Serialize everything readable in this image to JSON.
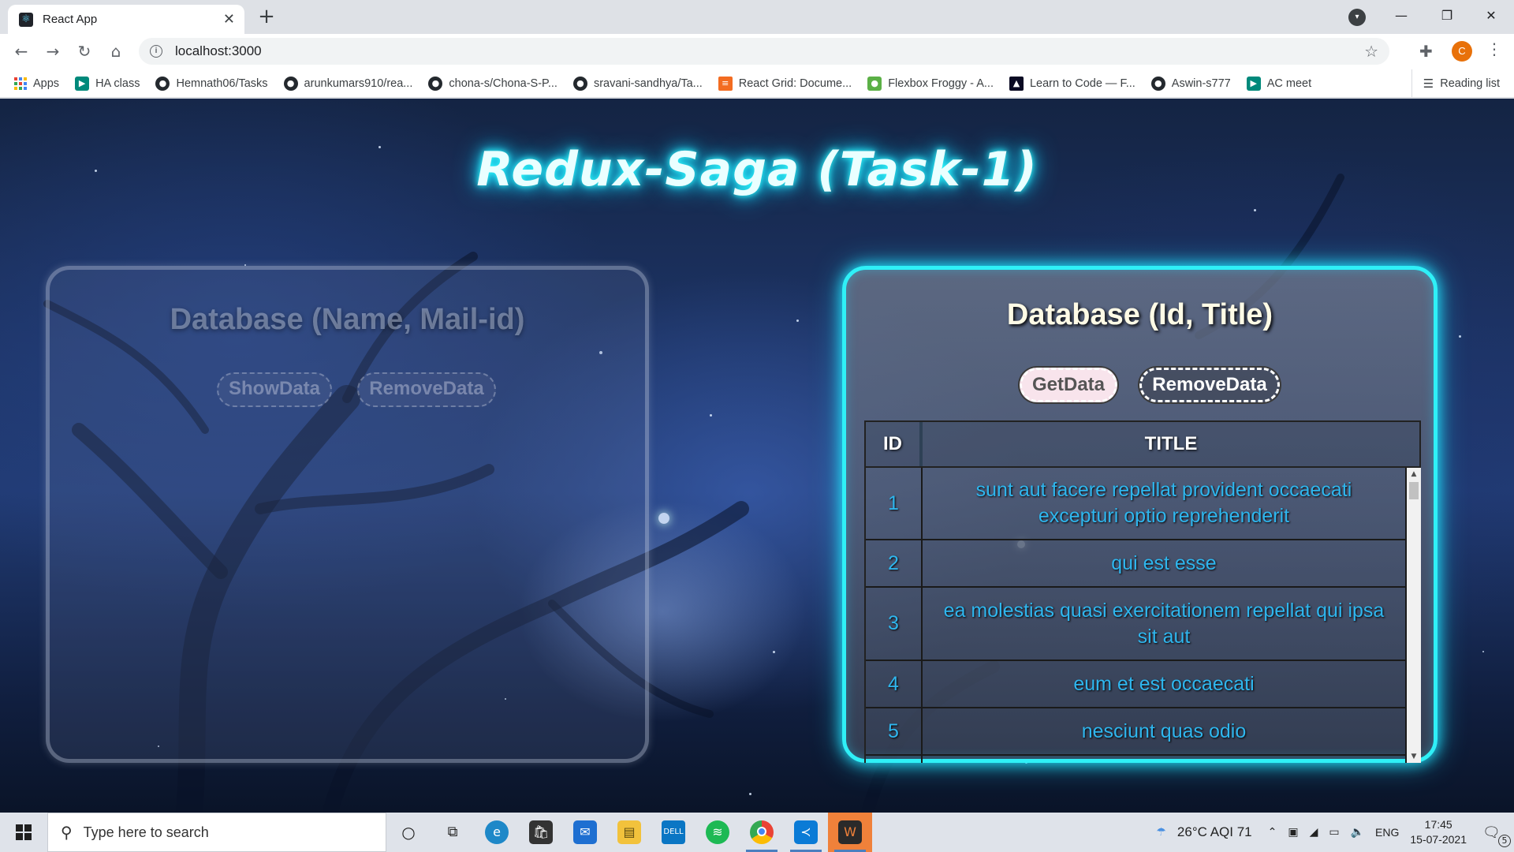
{
  "browser": {
    "tab_title": "React App",
    "tab_close": "✕",
    "new_tab": "+",
    "url": "localhost:3000",
    "window_controls": {
      "minimize": "—",
      "maximize": "❐",
      "close": "✕"
    },
    "profile_initial": "C"
  },
  "bookmarks": {
    "items": [
      {
        "label": "Apps",
        "icon": "apps-grid-icon"
      },
      {
        "label": "HA class",
        "icon": "meet-icon"
      },
      {
        "label": "Hemnath06/Tasks",
        "icon": "github-icon"
      },
      {
        "label": "arunkumars910/rea...",
        "icon": "github-icon"
      },
      {
        "label": "chona-s/Chona-S-P...",
        "icon": "github-icon"
      },
      {
        "label": "sravani-sandhya/Ta...",
        "icon": "github-icon"
      },
      {
        "label": "React Grid: Docume...",
        "icon": "react-grid-icon"
      },
      {
        "label": "Flexbox Froggy - A...",
        "icon": "froggy-icon"
      },
      {
        "label": "Learn to Code — F...",
        "icon": "freecodecamp-icon"
      },
      {
        "label": "Aswin-s777",
        "icon": "github-icon"
      },
      {
        "label": "AC meet",
        "icon": "meet-icon"
      }
    ],
    "reading_list": "Reading list"
  },
  "page": {
    "title": "Redux-Saga (Task-1)",
    "left_card": {
      "heading": "Database (Name, Mail-id)",
      "show_button": "ShowData",
      "remove_button": "RemoveData"
    },
    "right_card": {
      "heading": "Database (Id, Title)",
      "get_button": "GetData",
      "remove_button": "RemoveData",
      "table": {
        "headers": [
          "ID",
          "TITLE"
        ],
        "rows": [
          {
            "id": "1",
            "title": "sunt aut facere repellat provident occaecati excepturi optio reprehenderit"
          },
          {
            "id": "2",
            "title": "qui est esse"
          },
          {
            "id": "3",
            "title": "ea molestias quasi exercitationem repellat qui ipsa sit aut"
          },
          {
            "id": "4",
            "title": "eum et est occaecati"
          },
          {
            "id": "5",
            "title": "nesciunt quas odio"
          }
        ]
      }
    }
  },
  "taskbar": {
    "search_placeholder": "Type here to search",
    "weather": "26°C  AQI 71",
    "language": "ENG",
    "time": "17:45",
    "date": "15-07-2021",
    "notification_count": "5"
  },
  "colors": {
    "neon_cyan": "#2ff0f7",
    "table_text": "#2fb6ee",
    "heading_cream": "#fffbe6"
  }
}
